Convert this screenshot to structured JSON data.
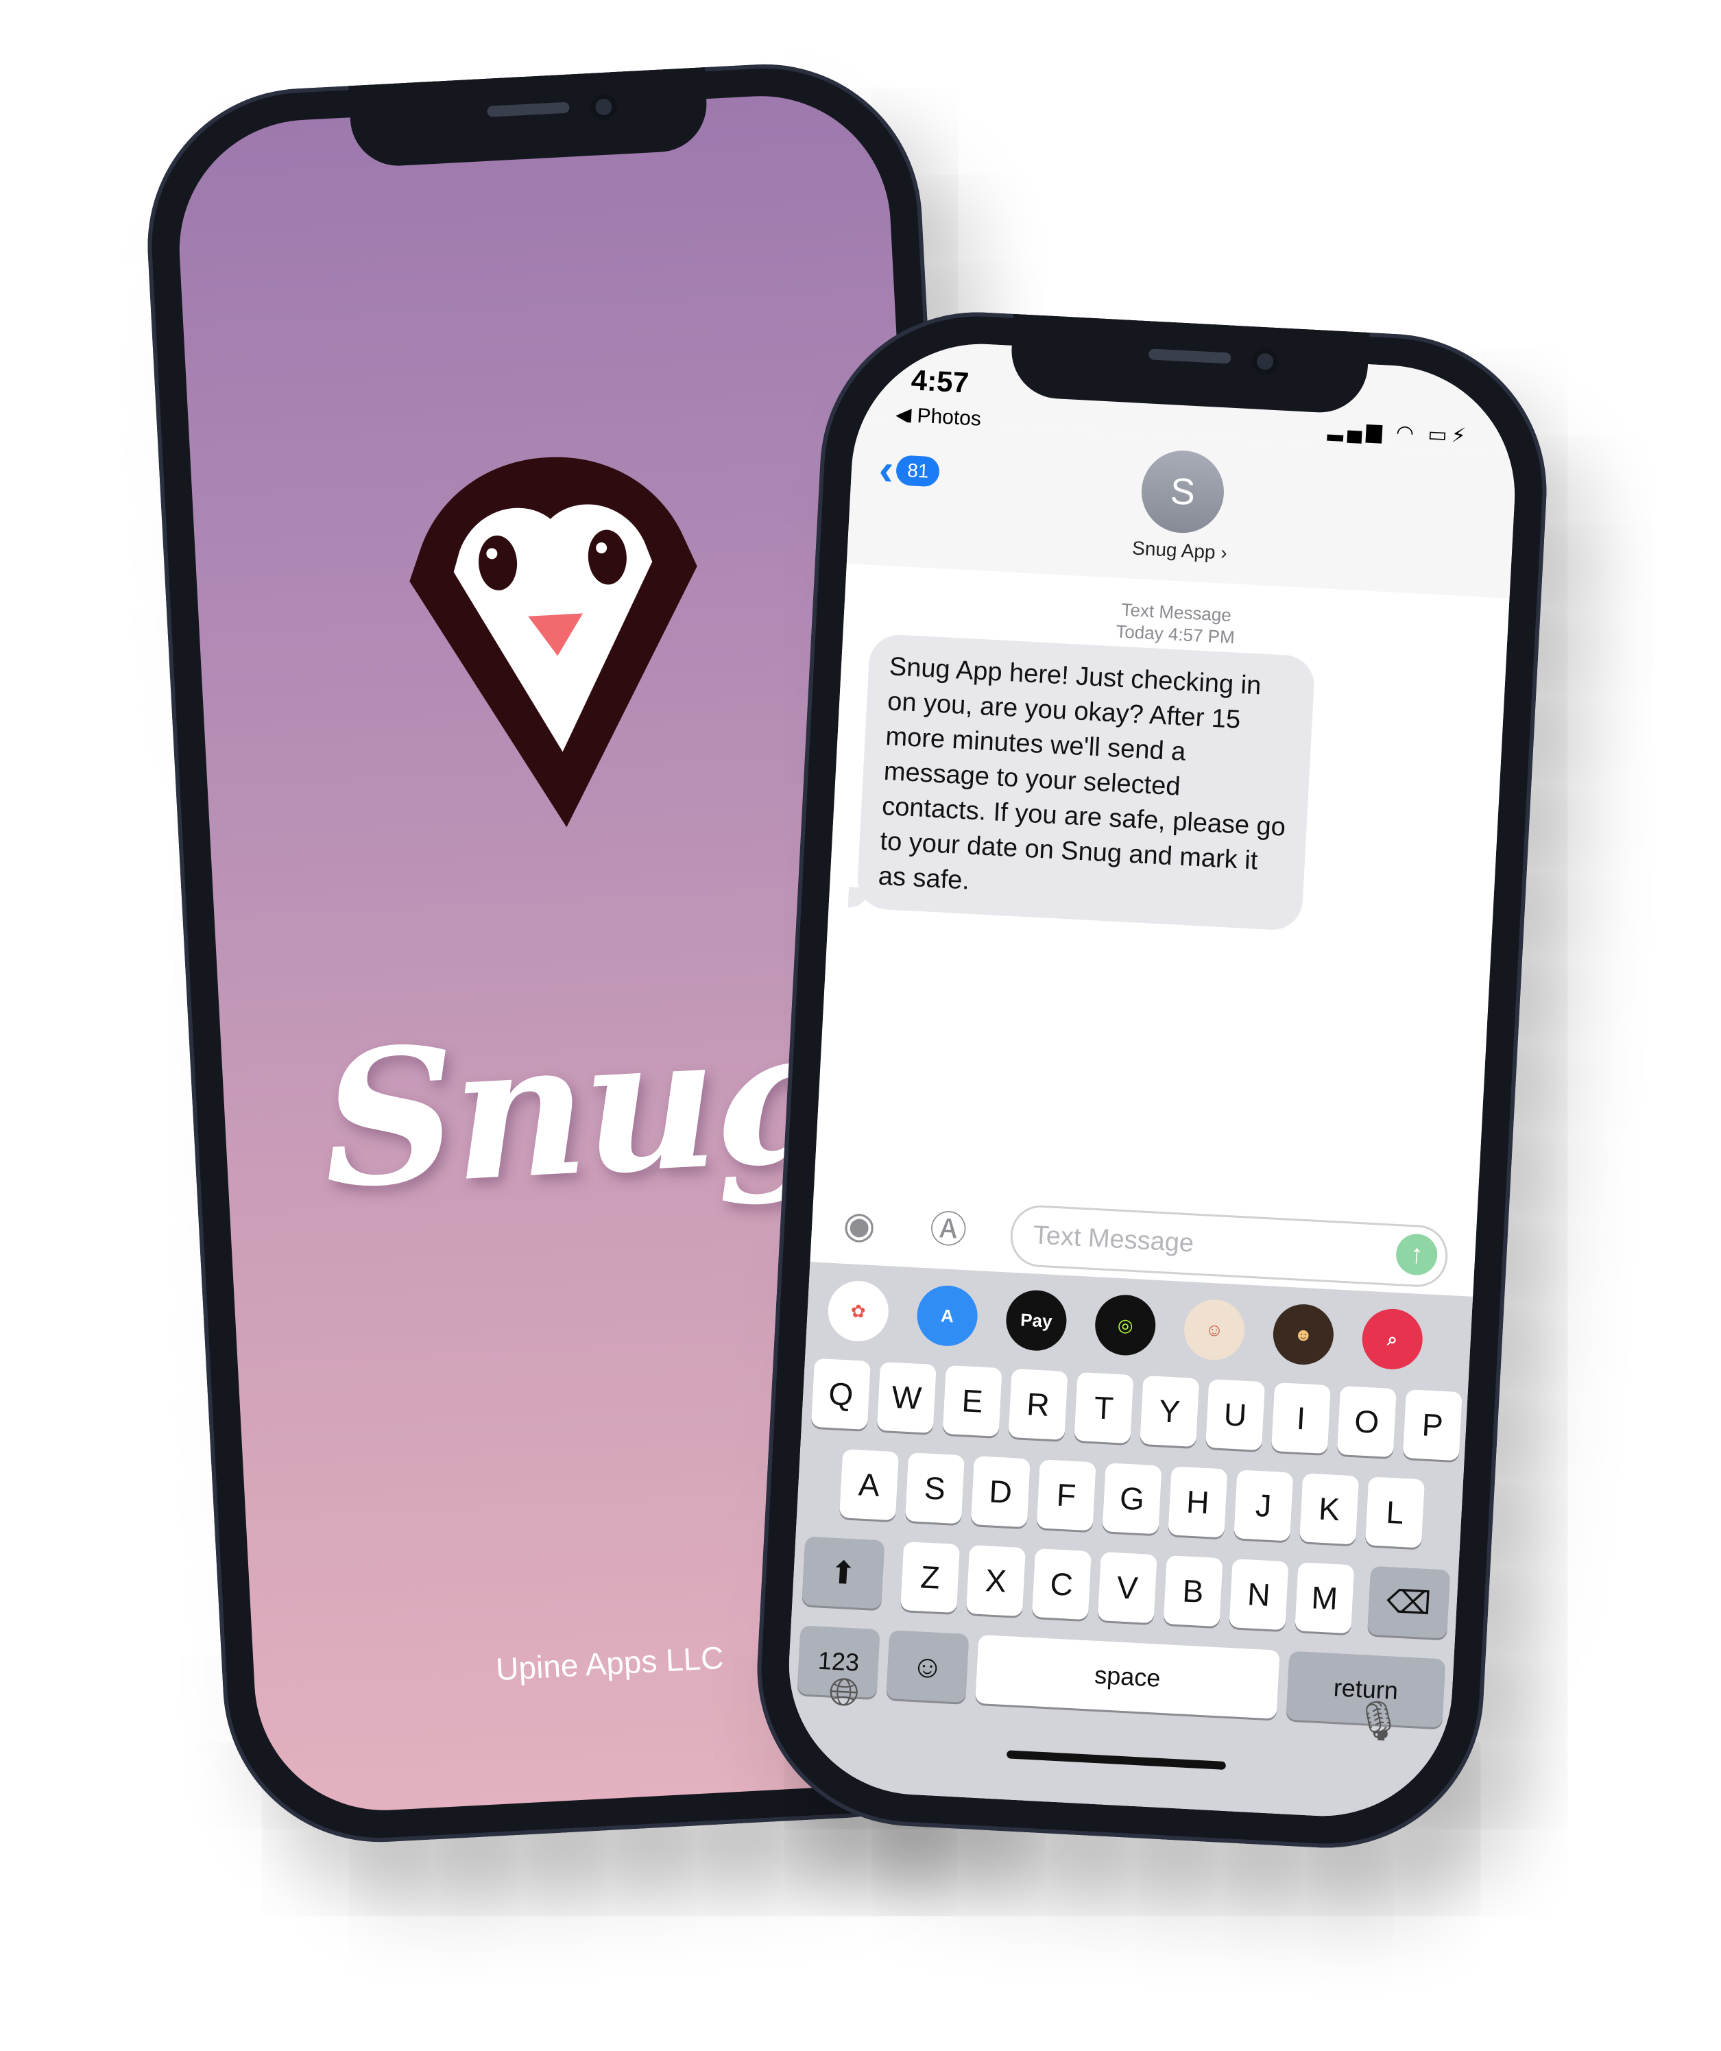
{
  "left_phone": {
    "brand": "Snug",
    "company": "Upine Apps LLC",
    "logo_icon": "penguin-heart-logo",
    "colors": {
      "gradient_top": "#9d79ad",
      "gradient_bottom": "#e3b1bf",
      "logo_dark": "#2e0b0f",
      "beak": "#f26a6e"
    }
  },
  "right_phone": {
    "status": {
      "time": "4:57",
      "back_app": "◀ Photos",
      "icons": [
        "signal-icon",
        "wifi-icon",
        "battery-charging-icon"
      ]
    },
    "header": {
      "back_badge": "81",
      "avatar_letter": "S",
      "contact_name": "Snug App ›"
    },
    "thread": {
      "meta_line1": "Text Message",
      "meta_line2": "Today 4:57 PM",
      "message": "Snug App here! Just checking in on you, are you okay? After 15 more minutes we'll send a message to your selected contacts. If you are safe, please go to your date on Snug and mark it as safe."
    },
    "composer": {
      "placeholder": "Text Message",
      "icons": [
        "camera-icon",
        "app-store-icon",
        "send-arrow-icon"
      ]
    },
    "app_drawer": [
      "photos-icon",
      "app-store-icon",
      "apple-pay-icon",
      "activity-icon",
      "memoji-stickers-icon",
      "animoji-icon",
      "image-search-icon"
    ],
    "apple_pay_label": "Pay",
    "keyboard": {
      "row1": [
        "Q",
        "W",
        "E",
        "R",
        "T",
        "Y",
        "U",
        "I",
        "O",
        "P"
      ],
      "row2": [
        "A",
        "S",
        "D",
        "F",
        "G",
        "H",
        "J",
        "K",
        "L"
      ],
      "row3": [
        "Z",
        "X",
        "C",
        "V",
        "B",
        "N",
        "M"
      ],
      "numbers_key": "123",
      "space_key": "space",
      "return_key": "return"
    },
    "colors": {
      "imessage_blue": "#1b7cf5",
      "bubble_gray": "#e8e8ec",
      "send_green": "#8fd6a4",
      "keyboard_bg": "#d2d4d9"
    }
  }
}
